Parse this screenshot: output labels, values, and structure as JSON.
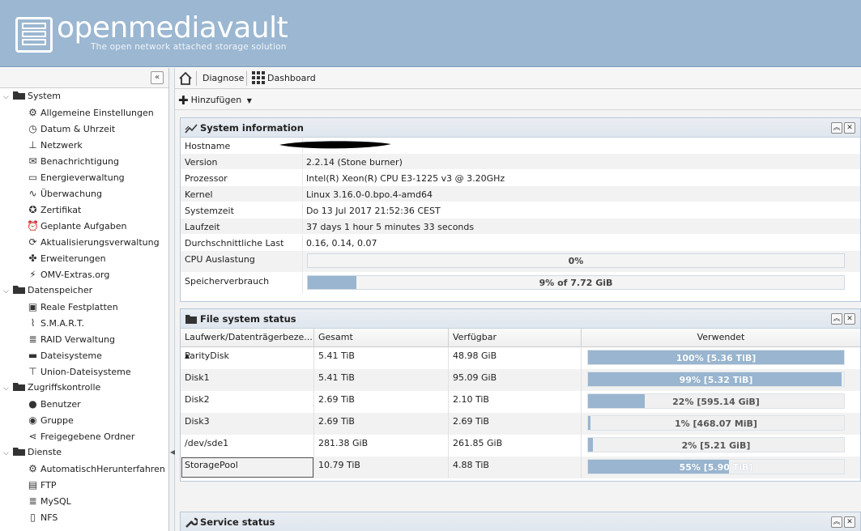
{
  "header": {
    "brand": "openmediavault",
    "tagline": "The open network attached storage solution"
  },
  "sidebar": {
    "collapse_label": "«",
    "categories": [
      {
        "label": "System",
        "items": [
          {
            "label": "Allgemeine Einstellungen",
            "icon": "gears-icon"
          },
          {
            "label": "Datum & Uhrzeit",
            "icon": "clock-icon"
          },
          {
            "label": "Netzwerk",
            "icon": "network-icon"
          },
          {
            "label": "Benachrichtigung",
            "icon": "mail-icon"
          },
          {
            "label": "Energieverwaltung",
            "icon": "battery-icon"
          },
          {
            "label": "Überwachung",
            "icon": "chart-icon"
          },
          {
            "label": "Zertifikat",
            "icon": "certificate-icon"
          },
          {
            "label": "Geplante Aufgaben",
            "icon": "alarm-icon"
          },
          {
            "label": "Aktualisierungsverwaltung",
            "icon": "update-icon"
          },
          {
            "label": "Erweiterungen",
            "icon": "puzzle-icon"
          },
          {
            "label": "OMV-Extras.org",
            "icon": "plug-icon"
          }
        ]
      },
      {
        "label": "Datenspeicher",
        "items": [
          {
            "label": "Reale Festplatten",
            "icon": "disk-icon"
          },
          {
            "label": "S.M.A.R.T.",
            "icon": "pulse-icon"
          },
          {
            "label": "RAID Verwaltung",
            "icon": "database-icon"
          },
          {
            "label": "Dateisysteme",
            "icon": "folder-icon"
          },
          {
            "label": "Union-Dateisysteme",
            "icon": "tree-icon"
          }
        ]
      },
      {
        "label": "Zugriffskontrolle",
        "items": [
          {
            "label": "Benutzer",
            "icon": "user-icon"
          },
          {
            "label": "Gruppe",
            "icon": "group-icon"
          },
          {
            "label": "Freigegebene Ordner",
            "icon": "share-icon"
          }
        ]
      },
      {
        "label": "Dienste",
        "items": [
          {
            "label": "AutomatischHerunterfahren",
            "icon": "gears-icon"
          },
          {
            "label": "FTP",
            "icon": "ftp-icon"
          },
          {
            "label": "MySQL",
            "icon": "database-icon"
          },
          {
            "label": "NFS",
            "icon": "file-icon"
          }
        ]
      }
    ]
  },
  "breadcrumb": {
    "items": [
      "Diagnose",
      "Dashboard"
    ]
  },
  "toolbar": {
    "add_label": "Hinzufügen"
  },
  "system_info": {
    "title": "System information",
    "rows": [
      {
        "label": "Hostname",
        "value": ""
      },
      {
        "label": "Version",
        "value": "2.2.14 (Stone burner)"
      },
      {
        "label": "Prozessor",
        "value": "Intel(R) Xeon(R) CPU E3-1225 v3 @ 3.20GHz"
      },
      {
        "label": "Kernel",
        "value": "Linux 3.16.0-0.bpo.4-amd64"
      },
      {
        "label": "Systemzeit",
        "value": "Do 13 Jul 2017 21:52:36 CEST"
      },
      {
        "label": "Laufzeit",
        "value": "37 days 1 hour 5 minutes 33 seconds"
      },
      {
        "label": "Durchschnittliche Last",
        "value": "0.16, 0.14, 0.07"
      }
    ],
    "cpu": {
      "label": "CPU Auslastung",
      "text": "0%",
      "fraction": 0.0
    },
    "memory": {
      "label": "Speicherverbrauch",
      "text": "9% of 7.72 GiB",
      "fraction": 0.09
    }
  },
  "fs_status": {
    "title": "File system status",
    "columns": [
      "Laufwerk/Datenträgerbeze...",
      "Gesamt",
      "Verfügbar",
      "Verwendet"
    ],
    "rows": [
      {
        "name": "ParityDisk",
        "total": "5.41 TiB",
        "free": "48.98 GiB",
        "used": "100% [5.36 TiB]",
        "fraction": 1.0
      },
      {
        "name": "Disk1",
        "total": "5.41 TiB",
        "free": "95.09 GiB",
        "used": "99% [5.32 TiB]",
        "fraction": 0.99
      },
      {
        "name": "Disk2",
        "total": "2.69 TiB",
        "free": "2.10 TiB",
        "used": "22% [595.14 GiB]",
        "fraction": 0.22
      },
      {
        "name": "Disk3",
        "total": "2.69 TiB",
        "free": "2.69 TiB",
        "used": "1% [468.07 MiB]",
        "fraction": 0.01
      },
      {
        "name": "/dev/sde1",
        "total": "281.38 GiB",
        "free": "261.85 GiB",
        "used": "2% [5.21 GiB]",
        "fraction": 0.02
      },
      {
        "name": "StoragePool",
        "total": "10.79 TiB",
        "free": "4.88 TiB",
        "used": "55% [5.90 TiB]",
        "fraction": 0.55
      }
    ]
  },
  "service_status": {
    "title": "Service status"
  }
}
